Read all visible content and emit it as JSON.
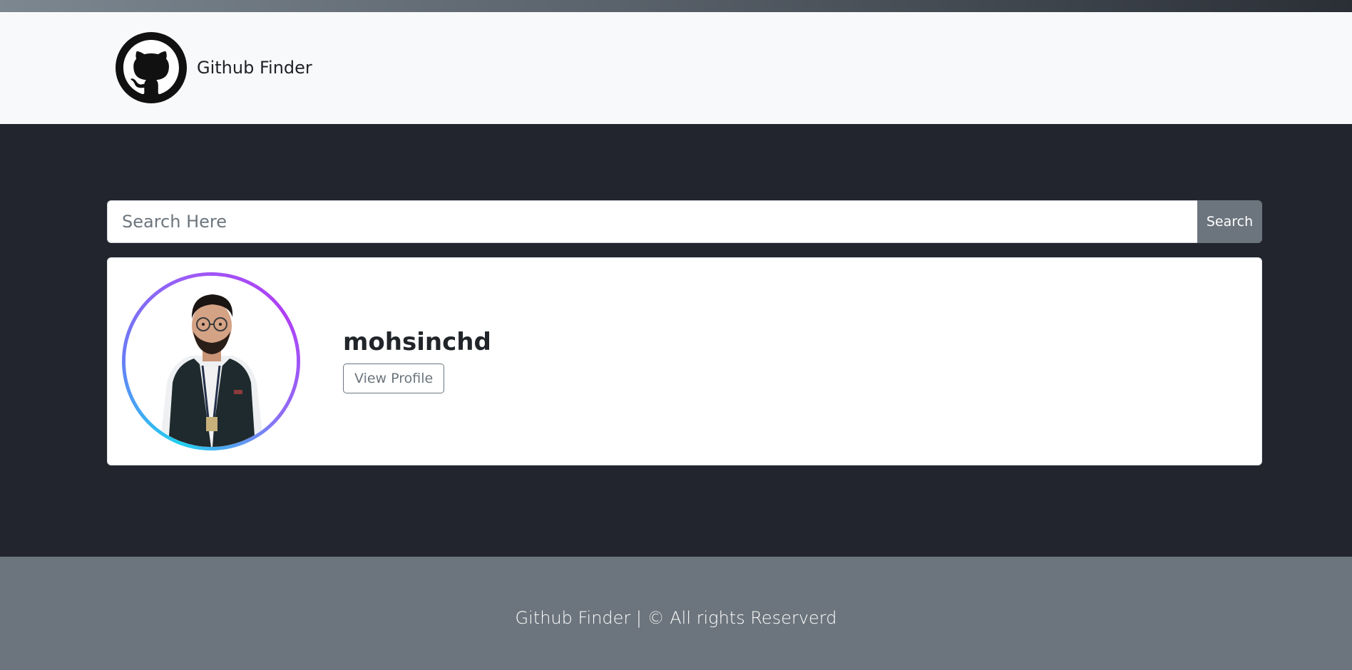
{
  "navbar": {
    "brand_title": "Github Finder",
    "logo_icon": "github-octocat-icon"
  },
  "search": {
    "placeholder": "Search Here",
    "value": "",
    "button_label": "Search"
  },
  "results": [
    {
      "username": "mohsinchd",
      "view_profile_label": "View Profile",
      "avatar_icon": "user-avatar-photo"
    }
  ],
  "footer": {
    "text": "Github Finder | © All rights Reserverd"
  },
  "colors": {
    "navbar_bg": "#f8f9fa",
    "main_bg": "#22252e",
    "footer_bg": "#6c757d",
    "button_bg": "#6c757d",
    "avatar_ring_start": "#20d0f0",
    "avatar_ring_end": "#b03ef5"
  }
}
